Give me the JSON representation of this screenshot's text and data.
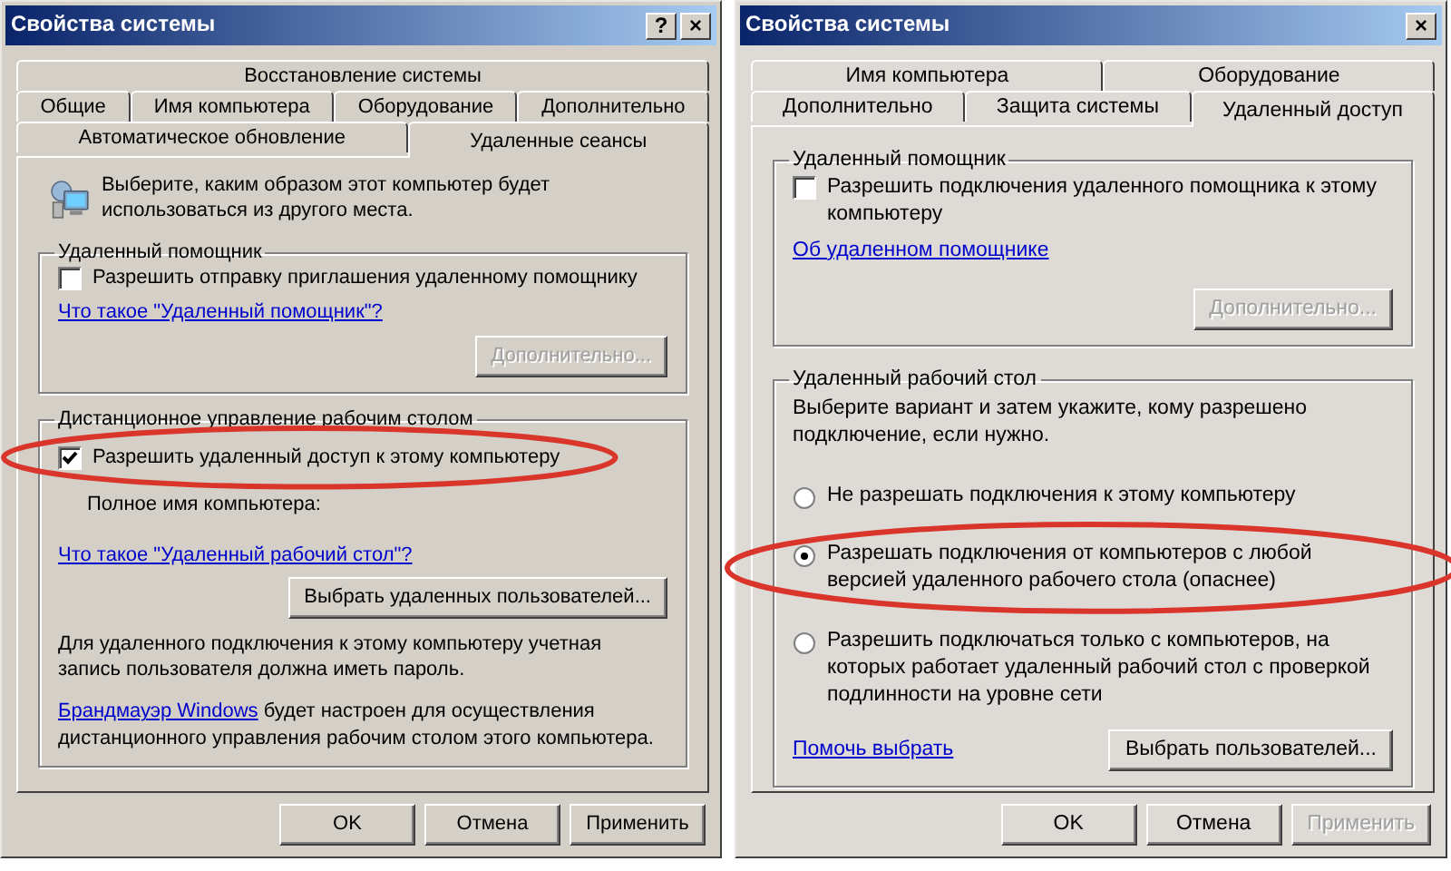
{
  "windows": [
    {
      "title": "Свойства системы",
      "title_buttons": [
        "?",
        "×"
      ],
      "tab_rows": [
        [
          {
            "label": "Восстановление системы",
            "selected": false
          }
        ],
        [
          {
            "label": "Общие",
            "selected": false
          },
          {
            "label": "Имя компьютера",
            "selected": false
          },
          {
            "label": "Оборудование",
            "selected": false
          },
          {
            "label": "Дополнительно",
            "selected": false
          }
        ],
        [
          {
            "label": "Автоматическое обновление",
            "selected": false
          },
          {
            "label": "Удаленные сеансы",
            "selected": true
          }
        ]
      ],
      "intro": "Выберите, каким образом этот компьютер будет использоваться из другого места.",
      "groups": [
        {
          "title": "Удаленный помощник",
          "items": [
            {
              "kind": "checkbox",
              "label": "Разрешить отправку приглашения удаленному помощнику",
              "checked": false,
              "circled": false
            },
            {
              "kind": "link",
              "text": "Что такое \"Удаленный помощник\"?"
            },
            {
              "kind": "button",
              "label": "Дополнительно...",
              "disabled": true
            }
          ]
        },
        {
          "title": "Дистанционное управление рабочим столом",
          "items": [
            {
              "kind": "checkbox",
              "label": "Разрешить удаленный доступ к этому компьютеру",
              "checked": true,
              "circled": true
            },
            {
              "kind": "label",
              "text": "Полное имя компьютера:"
            },
            {
              "kind": "link",
              "text": "Что такое \"Удаленный рабочий стол\"?"
            },
            {
              "kind": "button",
              "label": "Выбрать удаленных пользователей...",
              "disabled": false
            },
            {
              "kind": "text",
              "text": "Для удаленного подключения к этому компьютеру учетная запись пользователя должна иметь пароль."
            },
            {
              "kind": "link_text",
              "link": "Брандмауэр Windows",
              "text": "будет настроен для осуществления дистанционного управления рабочим столом этого компьютера."
            }
          ]
        }
      ],
      "buttons": [
        {
          "label": "OK",
          "disabled": false
        },
        {
          "label": "Отмена",
          "disabled": false
        },
        {
          "label": "Применить",
          "disabled": false
        }
      ]
    },
    {
      "title": "Свойства системы",
      "title_buttons": [
        "×"
      ],
      "tab_rows": [
        [
          {
            "label": "Имя компьютера",
            "selected": false
          },
          {
            "label": "Оборудование",
            "selected": false
          }
        ],
        [
          {
            "label": "Дополнительно",
            "selected": false
          },
          {
            "label": "Защита системы",
            "selected": false
          },
          {
            "label": "Удаленный доступ",
            "selected": true
          }
        ]
      ],
      "groups": [
        {
          "title": "Удаленный помощник",
          "items": [
            {
              "kind": "checkbox",
              "label": "Разрешить подключения удаленного помощника к этому компьютеру",
              "checked": false,
              "circled": false
            },
            {
              "kind": "link",
              "text": "Об удаленном помощнике"
            },
            {
              "kind": "button",
              "label": "Дополнительно...",
              "disabled": true
            }
          ]
        },
        {
          "title": "Удаленный рабочий стол",
          "items": [
            {
              "kind": "text",
              "text": "Выберите вариант и затем укажите, кому разрешено подключение, если нужно."
            },
            {
              "kind": "radio",
              "label": "Не разрешать подключения к этому компьютеру",
              "selected": false,
              "circled": false
            },
            {
              "kind": "radio",
              "label": "Разрешать подключения от компьютеров с любой версией удаленного рабочего стола (опаснее)",
              "selected": true,
              "circled": true
            },
            {
              "kind": "radio",
              "label": "Разрешить подключаться только с компьютеров, на которых работает удаленный рабочий стол с проверкой подлинности на уровне сети",
              "selected": false,
              "circled": false
            },
            {
              "kind": "link_and_button",
              "link": "Помочь выбрать",
              "button": "Выбрать пользователей..."
            }
          ]
        }
      ],
      "buttons": [
        {
          "label": "OK",
          "disabled": false
        },
        {
          "label": "Отмена",
          "disabled": false
        },
        {
          "label": "Применить",
          "disabled": true
        }
      ]
    }
  ]
}
